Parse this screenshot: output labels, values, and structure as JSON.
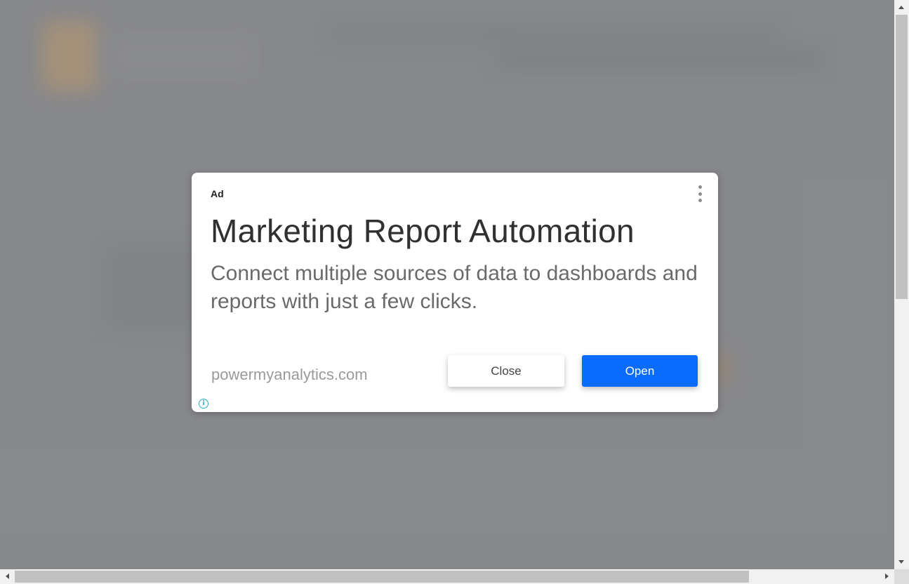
{
  "ad": {
    "label": "Ad",
    "headline": "Marketing Report Automation",
    "description": "Connect multiple sources of data to dashboards and reports with just a few clicks.",
    "domain": "powermyanalytics.com",
    "close_label": "Close",
    "open_label": "Open",
    "info_glyph": "i",
    "menu_icon": "more-vert-icon",
    "info_icon": "info-icon"
  },
  "colors": {
    "open_button": "#0a6cff",
    "info_icon": "#1ab0c8",
    "backdrop": "#8a8c8f"
  }
}
